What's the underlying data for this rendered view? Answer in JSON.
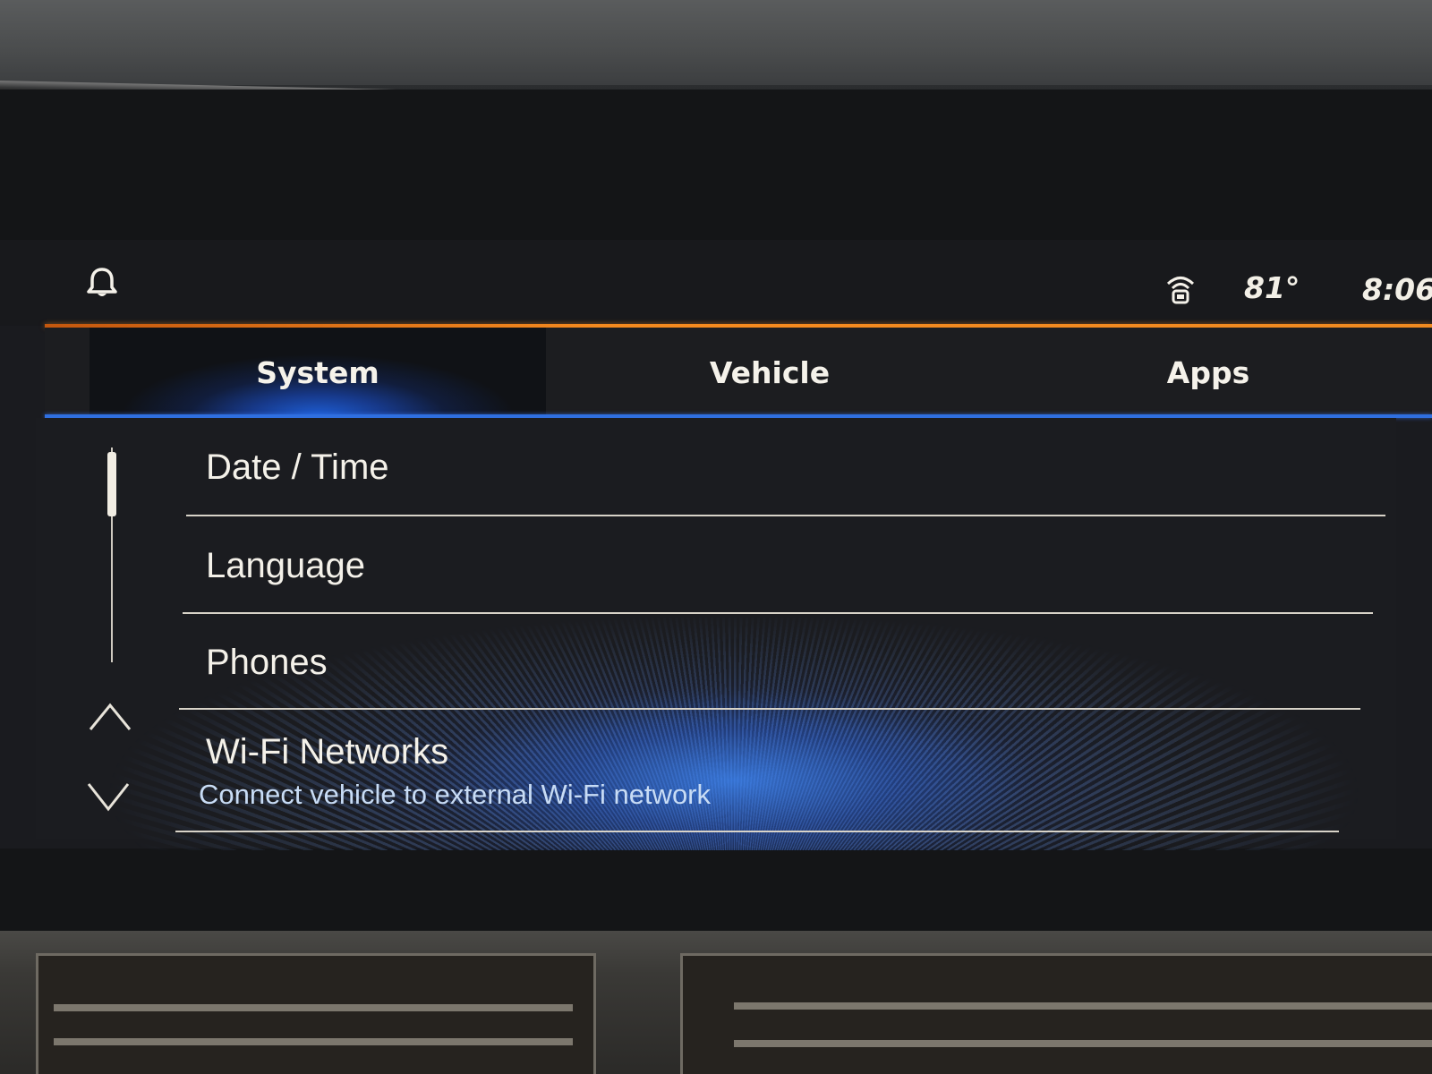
{
  "status_bar": {
    "temperature": "81°",
    "time": "8:06",
    "icons": [
      "bell-icon",
      "wifi-status-icon"
    ]
  },
  "tabs": [
    {
      "label": "System",
      "selected": true
    },
    {
      "label": "Vehicle",
      "selected": false
    },
    {
      "label": "Apps",
      "selected": false
    }
  ],
  "menu": {
    "items": [
      {
        "label": "Date / Time"
      },
      {
        "label": "Language"
      },
      {
        "label": "Phones"
      },
      {
        "label": "Wi-Fi Networks",
        "subtitle": "Connect vehicle to external Wi-Fi network"
      }
    ]
  },
  "colors": {
    "accent_orange": "#f58a1f",
    "accent_blue": "#2f6fe0",
    "text": "#f4f1e9",
    "subtitle_text": "#c8dcf5"
  }
}
